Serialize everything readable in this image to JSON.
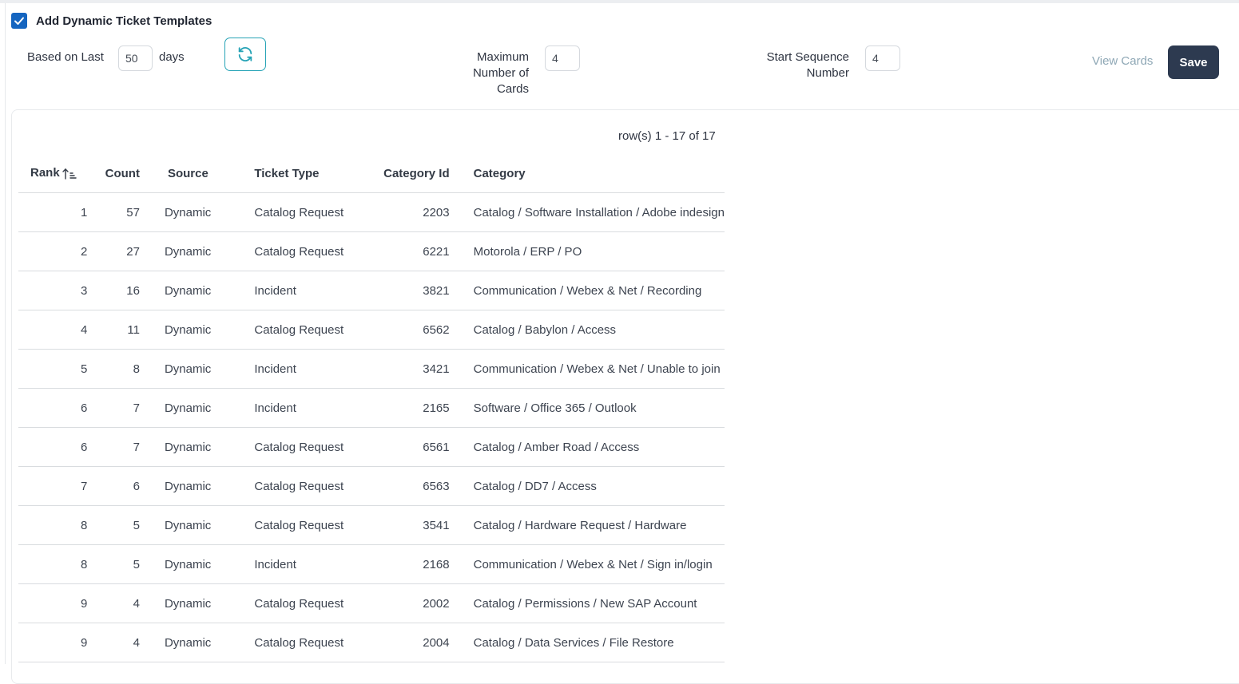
{
  "header": {
    "checkbox_label": "Add Dynamic Ticket Templates",
    "checked": true
  },
  "controls": {
    "based_on_label": "Based on Last",
    "days_value": "50",
    "days_label": "days",
    "max_cards_label_line1": "Maximum",
    "max_cards_label_line2": "Number of",
    "max_cards_label_line3": "Cards",
    "max_cards_value": "4",
    "start_seq_label_line1": "Start Sequence",
    "start_seq_label_line2": "Number",
    "start_seq_value": "4",
    "view_cards_label": "View Cards",
    "save_label": "Save"
  },
  "table": {
    "row_count_text": "row(s) 1 - 17 of 17",
    "columns": {
      "rank": "Rank",
      "count": "Count",
      "source": "Source",
      "ticket_type": "Ticket Type",
      "category_id": "Category Id",
      "category": "Category"
    },
    "rows": [
      {
        "rank": "1",
        "count": "57",
        "source": "Dynamic",
        "ticket_type": "Catalog Request",
        "category_id": "2203",
        "category": "Catalog / Software Installation / Adobe indesign"
      },
      {
        "rank": "2",
        "count": "27",
        "source": "Dynamic",
        "ticket_type": "Catalog Request",
        "category_id": "6221",
        "category": "Motorola / ERP / PO"
      },
      {
        "rank": "3",
        "count": "16",
        "source": "Dynamic",
        "ticket_type": "Incident",
        "category_id": "3821",
        "category": "Communication / Webex & Net / Recording"
      },
      {
        "rank": "4",
        "count": "11",
        "source": "Dynamic",
        "ticket_type": "Catalog Request",
        "category_id": "6562",
        "category": "Catalog / Babylon / Access"
      },
      {
        "rank": "5",
        "count": "8",
        "source": "Dynamic",
        "ticket_type": "Incident",
        "category_id": "3421",
        "category": "Communication / Webex & Net / Unable to join"
      },
      {
        "rank": "6",
        "count": "7",
        "source": "Dynamic",
        "ticket_type": "Incident",
        "category_id": "2165",
        "category": "Software / Office 365 / Outlook"
      },
      {
        "rank": "6",
        "count": "7",
        "source": "Dynamic",
        "ticket_type": "Catalog Request",
        "category_id": "6561",
        "category": "Catalog / Amber Road / Access"
      },
      {
        "rank": "7",
        "count": "6",
        "source": "Dynamic",
        "ticket_type": "Catalog Request",
        "category_id": "6563",
        "category": "Catalog / DD7 / Access"
      },
      {
        "rank": "8",
        "count": "5",
        "source": "Dynamic",
        "ticket_type": "Catalog Request",
        "category_id": "3541",
        "category": "Catalog / Hardware Request / Hardware"
      },
      {
        "rank": "8",
        "count": "5",
        "source": "Dynamic",
        "ticket_type": "Incident",
        "category_id": "2168",
        "category": "Communication / Webex & Net / Sign in/login"
      },
      {
        "rank": "9",
        "count": "4",
        "source": "Dynamic",
        "ticket_type": "Catalog Request",
        "category_id": "2002",
        "category": "Catalog / Permissions / New SAP Account"
      },
      {
        "rank": "9",
        "count": "4",
        "source": "Dynamic",
        "ticket_type": "Catalog Request",
        "category_id": "2004",
        "category": "Catalog / Data Services / File Restore"
      }
    ]
  },
  "icons": {
    "checkbox": "check-icon",
    "refresh": "refresh-icon",
    "sort": "sort-ascending-icon"
  },
  "colors": {
    "checkbox": "#1565c0",
    "refresh_border": "#26a3b6",
    "save_bg": "#2d3a50",
    "view_cards": "#8ea7b5"
  }
}
